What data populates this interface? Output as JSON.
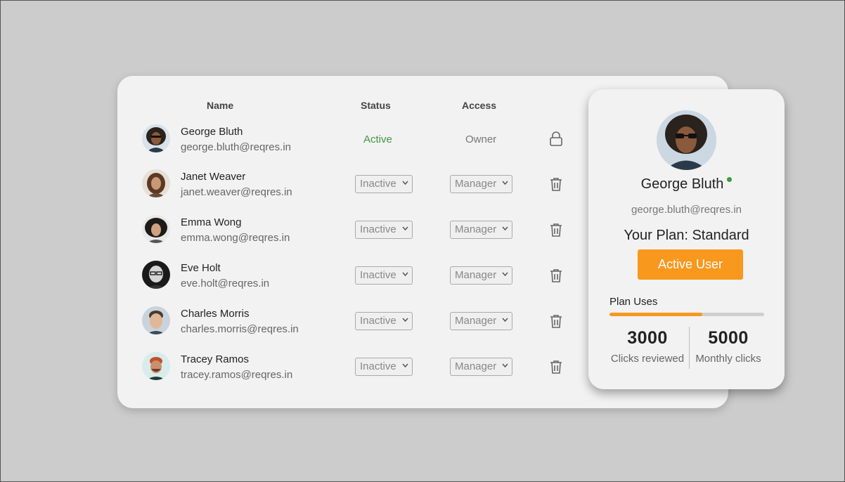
{
  "table": {
    "headers": {
      "name": "Name",
      "status": "Status",
      "access": "Access"
    },
    "users": [
      {
        "name": "George Bluth",
        "email": "george.bluth@reqres.in",
        "status": "Active",
        "access": "Owner",
        "action_icon": "lock-icon"
      },
      {
        "name": "Janet Weaver",
        "email": "janet.weaver@reqres.in",
        "status": "Inactive",
        "access": "Manager",
        "action_icon": "trash-icon"
      },
      {
        "name": "Emma Wong",
        "email": "emma.wong@reqres.in",
        "status": "Inactive",
        "access": "Manager",
        "action_icon": "trash-icon"
      },
      {
        "name": "Eve Holt",
        "email": "eve.holt@reqres.in",
        "status": "Inactive",
        "access": "Manager",
        "action_icon": "trash-icon"
      },
      {
        "name": "Charles Morris",
        "email": "charles.morris@reqres.in",
        "status": "Inactive",
        "access": "Manager",
        "action_icon": "trash-icon"
      },
      {
        "name": "Tracey Ramos",
        "email": "tracey.ramos@reqres.in",
        "status": "Inactive",
        "access": "Manager",
        "action_icon": "trash-icon"
      }
    ]
  },
  "profile": {
    "name": "George Bluth",
    "email": "george.bluth@reqres.in",
    "plan": "Your Plan: Standard",
    "button_label": "Active User",
    "uses_label": "Plan Uses",
    "uses_fraction": 0.6,
    "stats": [
      {
        "value": "3000",
        "label": "Clicks reviewed"
      },
      {
        "value": "5000",
        "label": "Monthly clicks"
      }
    ]
  },
  "colors": {
    "accent": "#f8981d",
    "active_status": "#3f9a3f",
    "online_dot": "#3f9a3f"
  }
}
